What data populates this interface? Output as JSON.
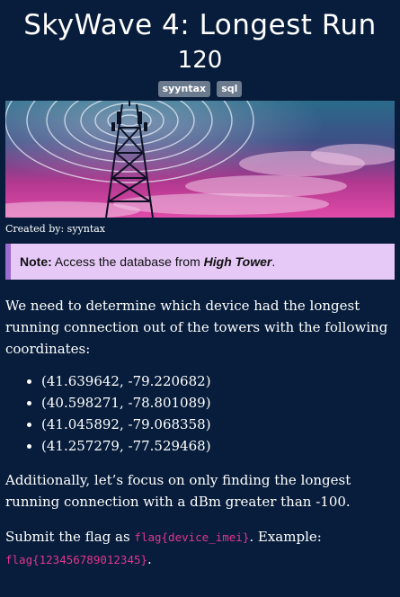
{
  "challenge": {
    "title": "SkyWave 4: Longest Run",
    "points": "120",
    "tags": [
      "syyntax",
      "sql"
    ],
    "created_by": "Created by: syyntax"
  },
  "note": {
    "label": "Note:",
    "text_before": " Access the database from ",
    "highlight": "High Tower",
    "text_after": "."
  },
  "description": {
    "intro": "We need to determine which device had the longest running connection out of the towers with the following coordinates:",
    "coordinates": [
      "(41.639642, -79.220682)",
      "(40.598271, -78.801089)",
      "(41.045892, -79.068358)",
      "(41.257279, -77.529468)"
    ],
    "additional": "Additionally, let’s focus on only finding the longest running connection with a dBm greater than -100.",
    "submit_before": "Submit the flag as ",
    "flag_format": "flag{device_imei}",
    "submit_middle": ". Example: ",
    "flag_example": "flag{123456789012345}",
    "submit_after": "."
  },
  "colors": {
    "background": "#071d3b",
    "note_bg": "#e6c9f7",
    "note_border": "#9e6bd0",
    "code": "#e2368f",
    "tag_bg": "#6c7a8d"
  }
}
